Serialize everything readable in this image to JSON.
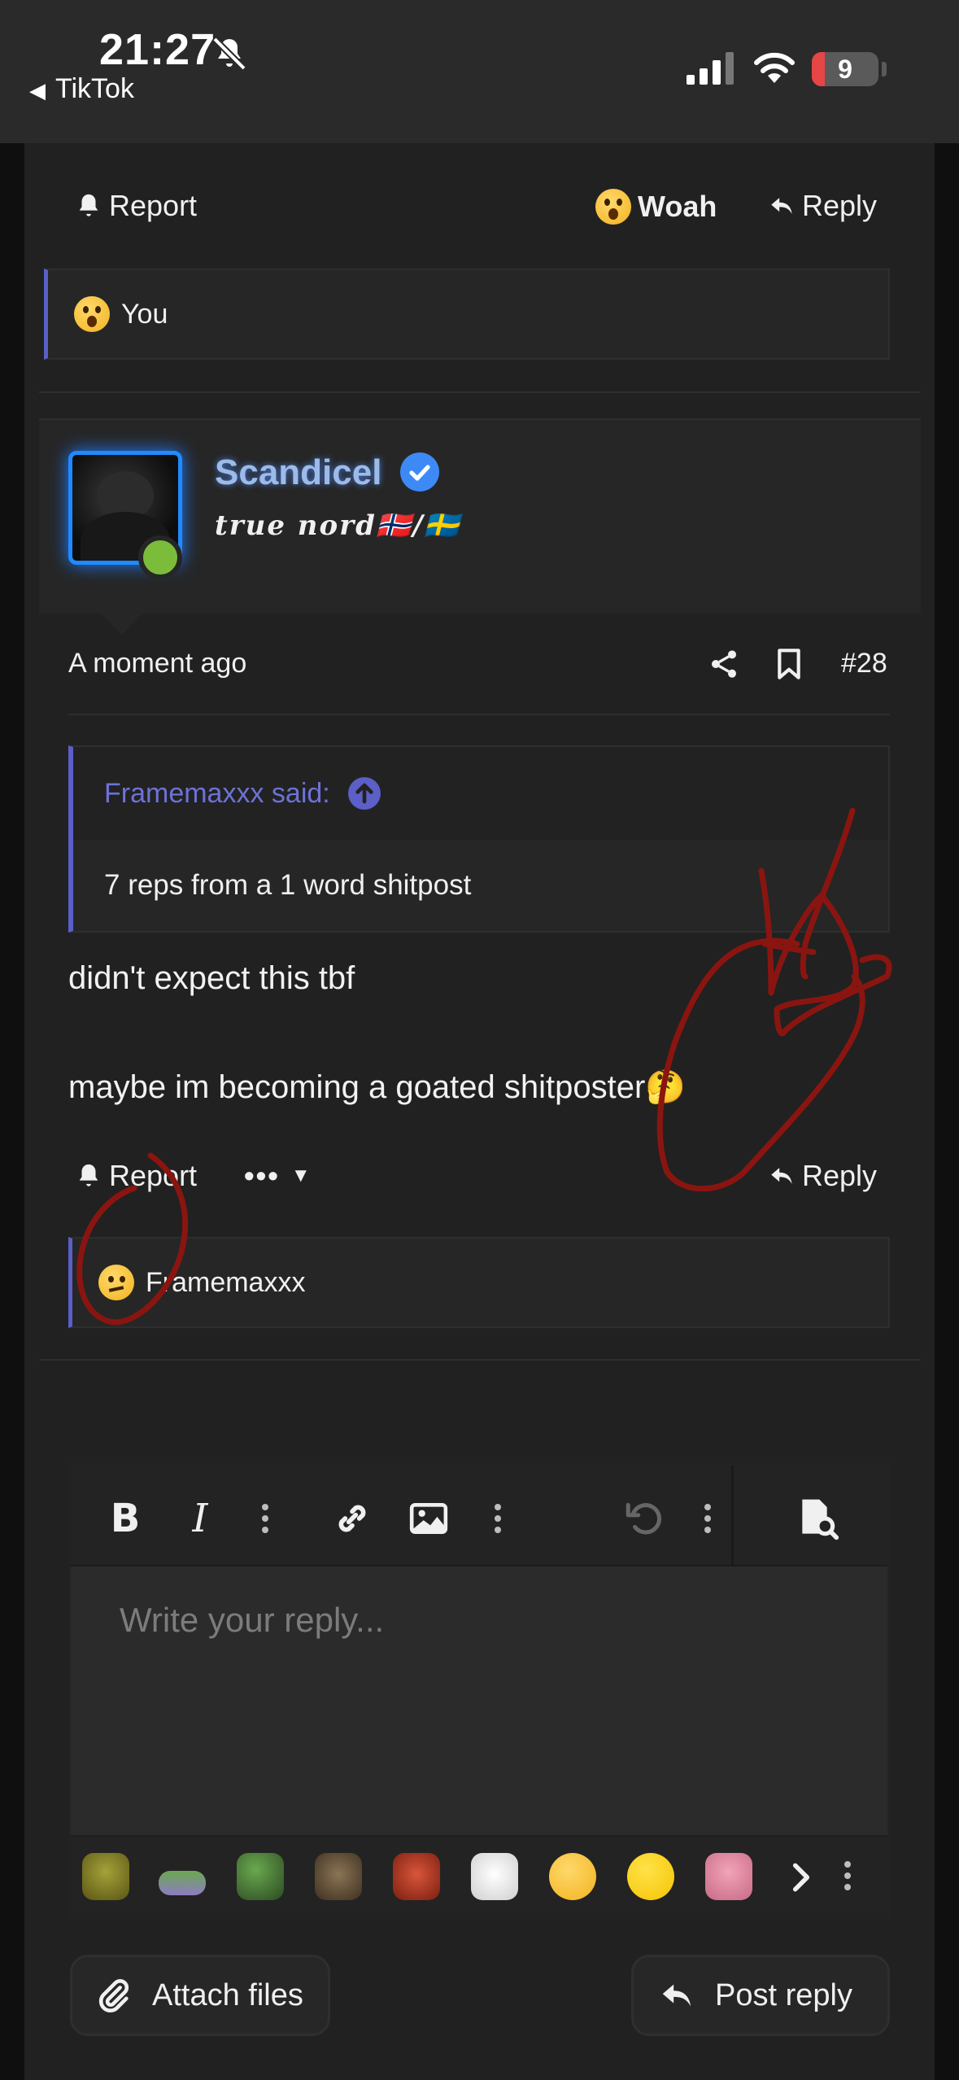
{
  "status_bar": {
    "time": "21:27",
    "back_app": "TikTok",
    "battery": "9"
  },
  "prev_post": {
    "report_label": "Report",
    "reaction_label": "Woah",
    "reply_label": "Reply",
    "reacted_by": "You"
  },
  "post": {
    "username": "Scandicel",
    "user_title": "𝒕𝒓𝒖𝒆 𝒏𝒐𝒓𝒅🇳🇴/🇸🇪",
    "timestamp": "A moment ago",
    "post_number": "#28",
    "quote_author": "Framemaxxx said:",
    "quote_text": "7 reps from a 1 word shitpost",
    "body_line1": "didn't expect this tbf",
    "body_line2": "maybe im becoming a goated shitposter🤔",
    "report_label": "Report",
    "more_label": "•••",
    "reply_label": "Reply",
    "reacted_by": "Framemaxxx"
  },
  "editor": {
    "placeholder": "Write your reply..."
  },
  "footer": {
    "attach_label": "Attach files",
    "post_label": "Post reply"
  },
  "colors": {
    "accent": "#5b5fc7",
    "username": "#9cbbe8",
    "online": "#7bbd3a",
    "scribble": "#8a1510"
  }
}
